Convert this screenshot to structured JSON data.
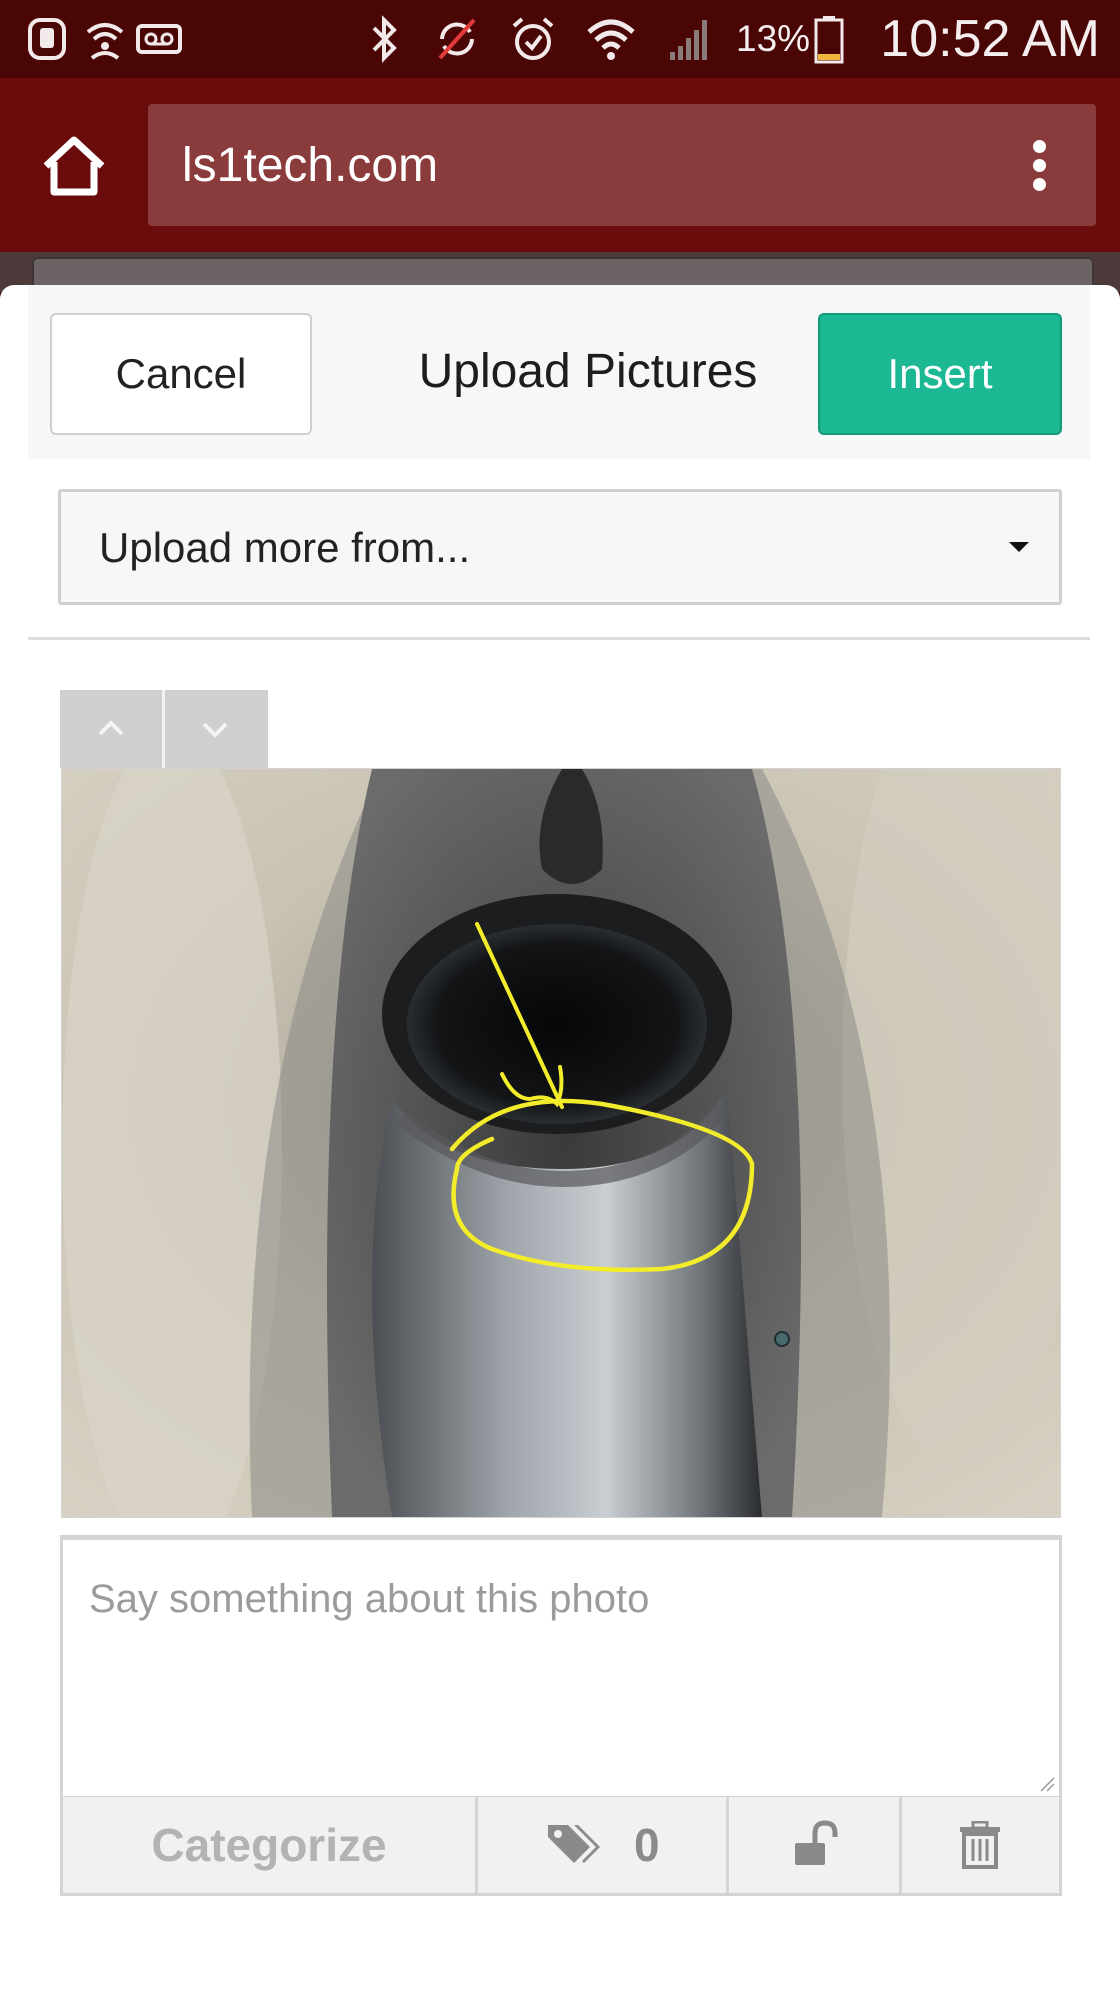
{
  "status_bar": {
    "battery": "13%",
    "time": "10:52 AM"
  },
  "browser": {
    "url": "ls1tech.com"
  },
  "modal": {
    "cancel_label": "Cancel",
    "title": "Upload Pictures",
    "insert_label": "Insert",
    "upload_more_label": "Upload more from...",
    "caption_placeholder": "Say something about this photo",
    "toolbar": {
      "categorize_label": "Categorize",
      "tag_count": "0"
    }
  },
  "colors": {
    "status_bar_bg": "#4a0505",
    "browser_bar_bg": "#6a0c0c",
    "url_box_bg": "#8a3b3b",
    "insert_button_bg": "#1cb894",
    "annotation_stroke": "#f2ec2a"
  },
  "icons": [
    "voicemail-icon",
    "bluetooth-icon",
    "alarm-icon",
    "wifi-icon",
    "signal-icon",
    "battery-icon",
    "home-icon",
    "overflow-menu-icon",
    "dropdown-caret-icon",
    "chevron-up-icon",
    "chevron-down-icon",
    "tag-icon",
    "unlock-icon",
    "trash-icon"
  ]
}
